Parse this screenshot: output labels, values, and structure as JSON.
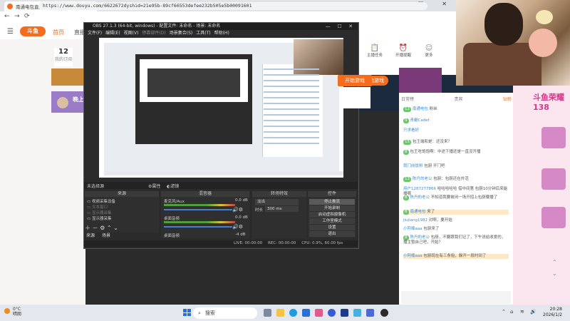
{
  "browser": {
    "tab_title": "南通电包直播_南通电包直播_南京",
    "tab_close": "×",
    "new_tab": "+",
    "url": "https://www.douyu.com/6622672dyshid=21e95b-89cf66553defee232b505e5b00091601",
    "controls": {
      "minimize": "—",
      "maximize": "☐",
      "close": "✕"
    },
    "nav": {
      "back": "←",
      "forward": "→",
      "reload": "⟳"
    }
  },
  "douyu": {
    "logo": "斗鱼",
    "nav_home": "首页",
    "nav_live": "直播",
    "badge_count": "12",
    "badge_label": "我的订阅",
    "streamer_tag": "晚上",
    "play_button": "开始游戏",
    "right_icons": [
      "主播任务",
      "开播提醒",
      "更多"
    ],
    "chat_tabs": [
      "日常榜",
      "贵宾",
      "钻粉"
    ],
    "chat_messages": [
      {
        "lv": "12",
        "name": "南通电包",
        "text": "粉丝"
      },
      {
        "lv": "9",
        "name": "青樾Cadet",
        "text": ""
      },
      {
        "lv": "",
        "name": "只求看好",
        "text": ""
      },
      {
        "lv": "15",
        "name": "",
        "text": "包王端和是：还没来？"
      },
      {
        "lv": "8",
        "name": "",
        "text": "包王吃饱饱啊：中途下播还是一直没开播"
      },
      {
        "lv": "",
        "name": "我门岗饭粉",
        "text": "包厨  开门吧"
      },
      {
        "lv": "13",
        "name": "陈丹的老公",
        "text": "包厨：包厨还在外活"
      },
      {
        "lv": "",
        "name": "用户1287277866",
        "text": "哈哈哈哈哈  借中间第  包厨10分钟后来能播哪"
      },
      {
        "lv": "8",
        "name": "陈丹的老公",
        "text": "不知道我要被闭一场开招上包厨要播了"
      },
      {
        "lv": "8",
        "name": "南通电包",
        "text": "来了"
      },
      {
        "lv": "",
        "name": "jiujiang1982",
        "text": "对啊，要开始"
      },
      {
        "lv": "",
        "name": "小阿楠aaa",
        "text": "包厨来了"
      },
      {
        "lv": "8",
        "name": "陈丹的老公",
        "text": "包厨，不要跟我们记了，下午说给收爱的，播主暂自己吧，开始？"
      },
      {
        "lv": "",
        "name": "小阿楠aaa",
        "text": "包厨现在有三条船，躲开一段时间了"
      }
    ],
    "deco_title": "斗鱼荣耀 138"
  },
  "obs": {
    "title": "OBS 27.1.3 (64-bit, windows) - 配置文件: 未命名 - 场景: 未命名",
    "menu": [
      "文件(F)",
      "编辑(E)",
      "视图(V)",
      "停靠部件(D)",
      "场景集合(S)",
      "工具(T)",
      "帮助(H)"
    ],
    "controls": {
      "minimize": "—",
      "maximize": "☐",
      "close": "✕"
    },
    "source_status": {
      "name": "未选择源",
      "prop": "属性",
      "filter": "滤镜"
    },
    "dock_titles": {
      "sources": "来源",
      "mixer": "混音器",
      "transitions": "转场特效",
      "controls": "控件"
    },
    "sources": [
      {
        "name": "视频采集设备",
        "dim": false
      },
      {
        "name": "文本窗口",
        "dim": true
      },
      {
        "name": "显示器采集",
        "dim": true
      },
      {
        "name": "显示器采集",
        "dim": false
      }
    ],
    "scene_tabs": [
      "来源",
      "场景"
    ],
    "mixer": [
      {
        "label": "麦克风/Aux",
        "value": "0.0 dB"
      },
      {
        "label": "桌面音频",
        "value": "0.0 dB"
      },
      {
        "label": "桌面音频",
        "value": "-4 dB"
      }
    ],
    "transitions": {
      "selected": "淡出",
      "duration_label": "时长",
      "duration": "300 ms"
    },
    "control_buttons": [
      "停止推流",
      "开始录制",
      "启动虚拟摄像机",
      "工作室模式",
      "设置",
      "退出"
    ],
    "status": {
      "live": "LIVE: 00:00:00",
      "rec": "REC: 00:00:00",
      "cpu": "CPU: 0.9%, 60.00 fps"
    }
  },
  "taskbar": {
    "weather_temp": "0°C",
    "weather_desc": "晴朗",
    "search": "搜索",
    "time": "20:28",
    "date": "2026/1/2"
  },
  "colors": {
    "accent": "#f46d1d",
    "obs_bg": "#2b2b2b",
    "chat_name": "#3a8fd9"
  }
}
